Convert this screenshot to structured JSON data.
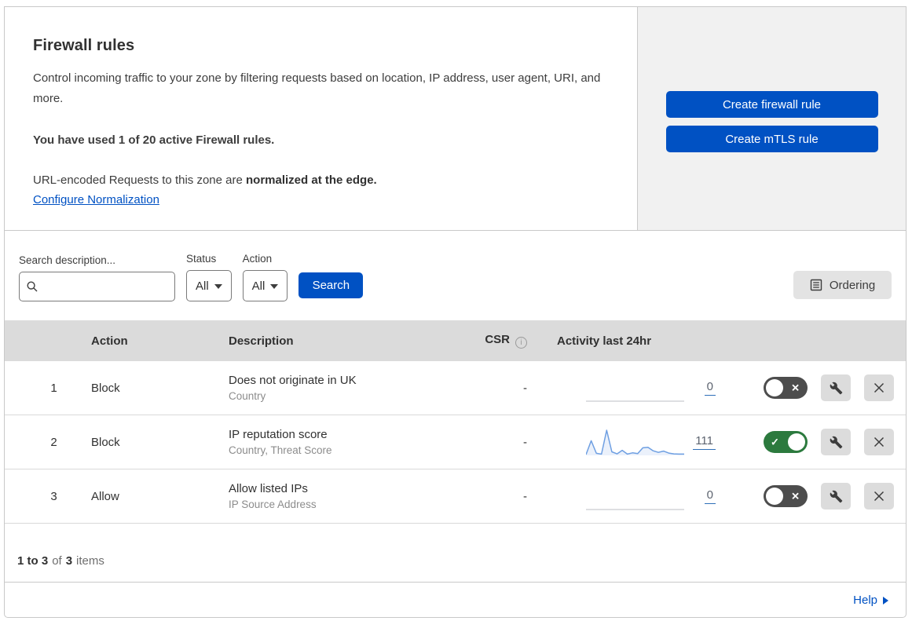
{
  "intro": {
    "title": "Firewall rules",
    "description": "Control incoming traffic to your zone by filtering requests based on location, IP address, user agent, URI, and more.",
    "usage": "You have used 1 of 20 active Firewall rules.",
    "normalization_prefix": "URL-encoded Requests to this zone are ",
    "normalization_bold": "normalized at the edge.",
    "normalization_link": "Configure Normalization"
  },
  "actions_panel": {
    "create_firewall_rule": "Create firewall rule",
    "create_mtls_rule": "Create mTLS rule"
  },
  "filters": {
    "search_label": "Search description...",
    "search_value": "",
    "status_label": "Status",
    "status_value": "All",
    "action_label": "Action",
    "action_value": "All",
    "search_button": "Search",
    "ordering_button": "Ordering"
  },
  "table": {
    "headers": {
      "action": "Action",
      "description": "Description",
      "csr": "CSR",
      "activity": "Activity last 24hr"
    },
    "rows": [
      {
        "priority": "1",
        "action": "Block",
        "description": "Does not originate in UK",
        "fields": "Country",
        "csr": "-",
        "activity_count": "0",
        "enabled": false,
        "sparkline": []
      },
      {
        "priority": "2",
        "action": "Block",
        "description": "IP reputation score",
        "fields": "Country, Threat Score",
        "csr": "-",
        "activity_count": "111",
        "enabled": true,
        "sparkline": [
          3,
          58,
          8,
          5,
          100,
          14,
          6,
          20,
          5,
          10,
          7,
          30,
          32,
          18,
          12,
          17,
          9,
          6,
          5,
          5
        ]
      },
      {
        "priority": "3",
        "action": "Allow",
        "description": "Allow listed IPs",
        "fields": "IP Source Address",
        "csr": "-",
        "activity_count": "0",
        "enabled": false,
        "sparkline": []
      }
    ]
  },
  "footer": {
    "range": "1 to 3",
    "of_word": "of",
    "total": "3",
    "items_word": "items"
  },
  "help": {
    "label": "Help"
  },
  "colors": {
    "accent_blue": "#0051c3",
    "toggle_on_green": "#2c7a3e",
    "toggle_off_gray": "#4d4d4d",
    "sparkline_blue": "#6e9fe2",
    "panel_gray": "#f1f1f1",
    "table_header_gray": "#dbdbdb"
  }
}
